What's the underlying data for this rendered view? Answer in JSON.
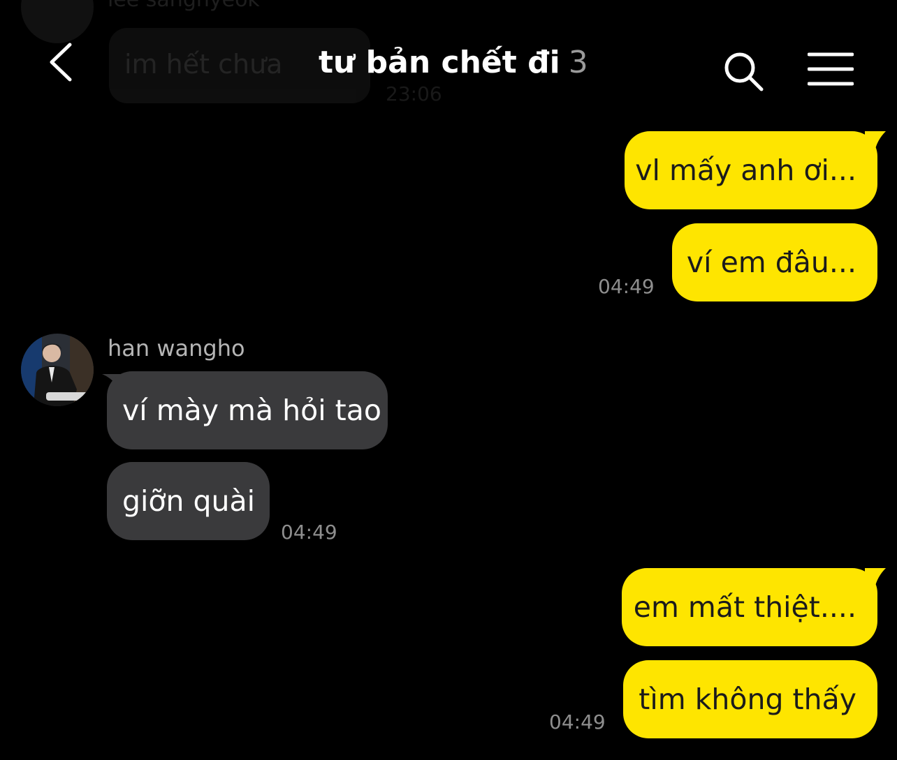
{
  "header": {
    "title": "tư bản chết đi",
    "member_count": "3",
    "back_icon": "chevron-left-icon",
    "search_icon": "search-icon",
    "menu_icon": "hamburger-menu-icon"
  },
  "previous_message": {
    "sender": "lee sanghyeok",
    "text": "im hết chưa",
    "time": "23:06"
  },
  "messages": [
    {
      "side": "me",
      "text": "vl mấy anh ơi..."
    },
    {
      "side": "me",
      "text": "ví em đâu...",
      "time": "04:49"
    },
    {
      "side": "other",
      "sender": "han wangho",
      "text": "ví mày mà hỏi tao"
    },
    {
      "side": "other",
      "sender": "han wangho",
      "text": "giỡn quài",
      "time": "04:49"
    },
    {
      "side": "me",
      "text": "em mất thiệt...."
    },
    {
      "side": "me",
      "text": "tìm không thấy",
      "time": "04:49"
    }
  ],
  "colors": {
    "background": "#000000",
    "my_bubble": "#fee500",
    "other_bubble": "#3a3a3c"
  }
}
